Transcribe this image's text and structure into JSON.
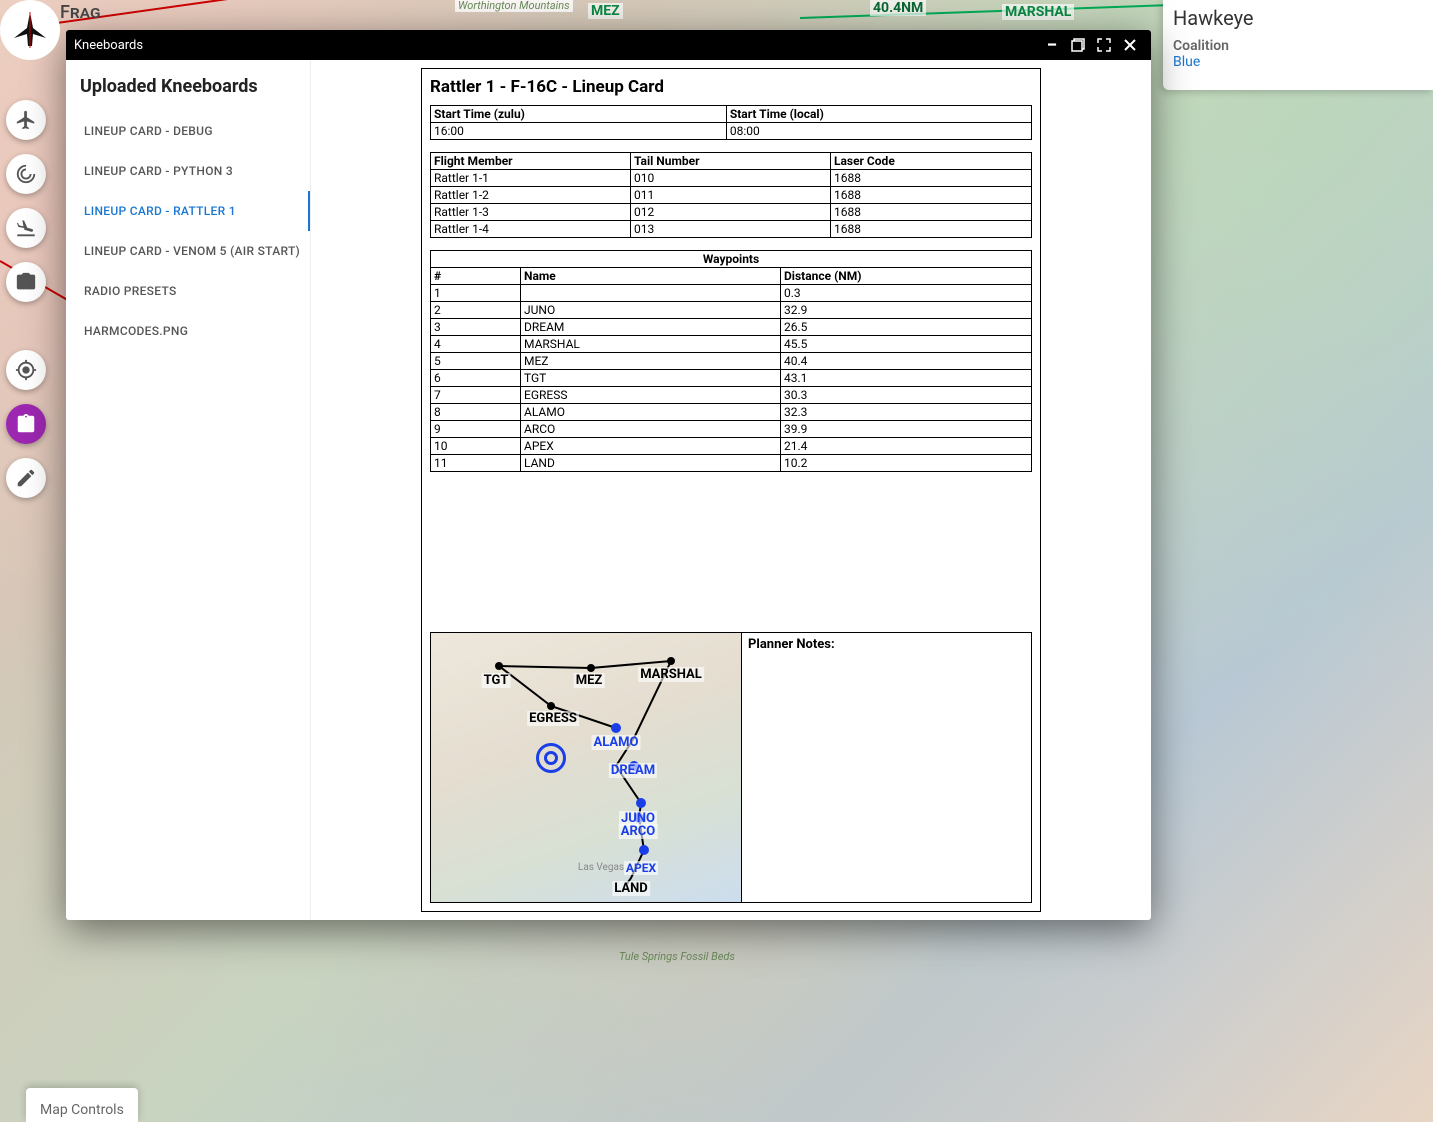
{
  "app_name": "Frag",
  "modal": {
    "title": "Kneeboards",
    "heading": "Uploaded Kneeboards",
    "items": [
      "LINEUP CARD - DEBUG",
      "LINEUP CARD - PYTHON 3",
      "LINEUP CARD - RATTLER 1",
      "LINEUP CARD - VENOM 5 (AIR START)",
      "RADIO PRESETS",
      "HARMCODES.PNG"
    ],
    "active_index": 2
  },
  "card": {
    "title": "Rattler 1 - F-16C - Lineup Card",
    "start_time": {
      "zulu_label": "Start Time (zulu)",
      "zulu": "16:00",
      "local_label": "Start Time (local)",
      "local": "08:00"
    },
    "members_header": {
      "flight": "Flight Member",
      "tail": "Tail Number",
      "laser": "Laser Code"
    },
    "members": [
      {
        "flight": "Rattler 1-1",
        "tail": "010",
        "laser": "1688"
      },
      {
        "flight": "Rattler 1-2",
        "tail": "011",
        "laser": "1688"
      },
      {
        "flight": "Rattler 1-3",
        "tail": "012",
        "laser": "1688"
      },
      {
        "flight": "Rattler 1-4",
        "tail": "013",
        "laser": "1688"
      }
    ],
    "wp_title": "Waypoints",
    "wp_header": {
      "n": "#",
      "name": "Name",
      "dist": "Distance (NM)"
    },
    "waypoints": [
      {
        "n": "1",
        "name": "",
        "dist": "0.3"
      },
      {
        "n": "2",
        "name": "JUNO",
        "dist": "32.9"
      },
      {
        "n": "3",
        "name": "DREAM",
        "dist": "26.5"
      },
      {
        "n": "4",
        "name": "MARSHAL",
        "dist": "45.5"
      },
      {
        "n": "5",
        "name": "MEZ",
        "dist": "40.4"
      },
      {
        "n": "6",
        "name": "TGT",
        "dist": "43.1"
      },
      {
        "n": "7",
        "name": "EGRESS",
        "dist": "30.3"
      },
      {
        "n": "8",
        "name": "ALAMO",
        "dist": "32.3"
      },
      {
        "n": "9",
        "name": "ARCO",
        "dist": "39.9"
      },
      {
        "n": "10",
        "name": "APEX",
        "dist": "21.4"
      },
      {
        "n": "11",
        "name": "LAND",
        "dist": "10.2"
      }
    ],
    "notes_label": "Planner Notes:",
    "minimap_labels": {
      "tgt": "TGT",
      "mez": "MEZ",
      "marshal": "MARSHAL",
      "egress": "EGRESS",
      "alamo": "ALAMO",
      "dream": "DREAM",
      "juno": "JUNO",
      "arco": "ARCO",
      "apex": "APEX",
      "land": "LAND",
      "lasvegas": "Las Vegas"
    }
  },
  "hawkeye": {
    "name": "Hawkeye",
    "coalition_label": "Coalition",
    "coalition": "Blue"
  },
  "map_controls_label": "Map Controls",
  "bg_labels": {
    "mez": "MEZ",
    "nm": "40.4NM",
    "marshal": "MARSHAL",
    "worthington": "Worthington Mountains",
    "tule": "Tule Springs Fossil Beds"
  },
  "icons": {
    "plane": "plane-icon",
    "gunsight": "radar-icon",
    "landing": "landing-icon",
    "camera": "camera-icon",
    "crosshair": "crosshair-icon",
    "clipboard": "clipboard-icon",
    "edit": "edit-icon"
  }
}
